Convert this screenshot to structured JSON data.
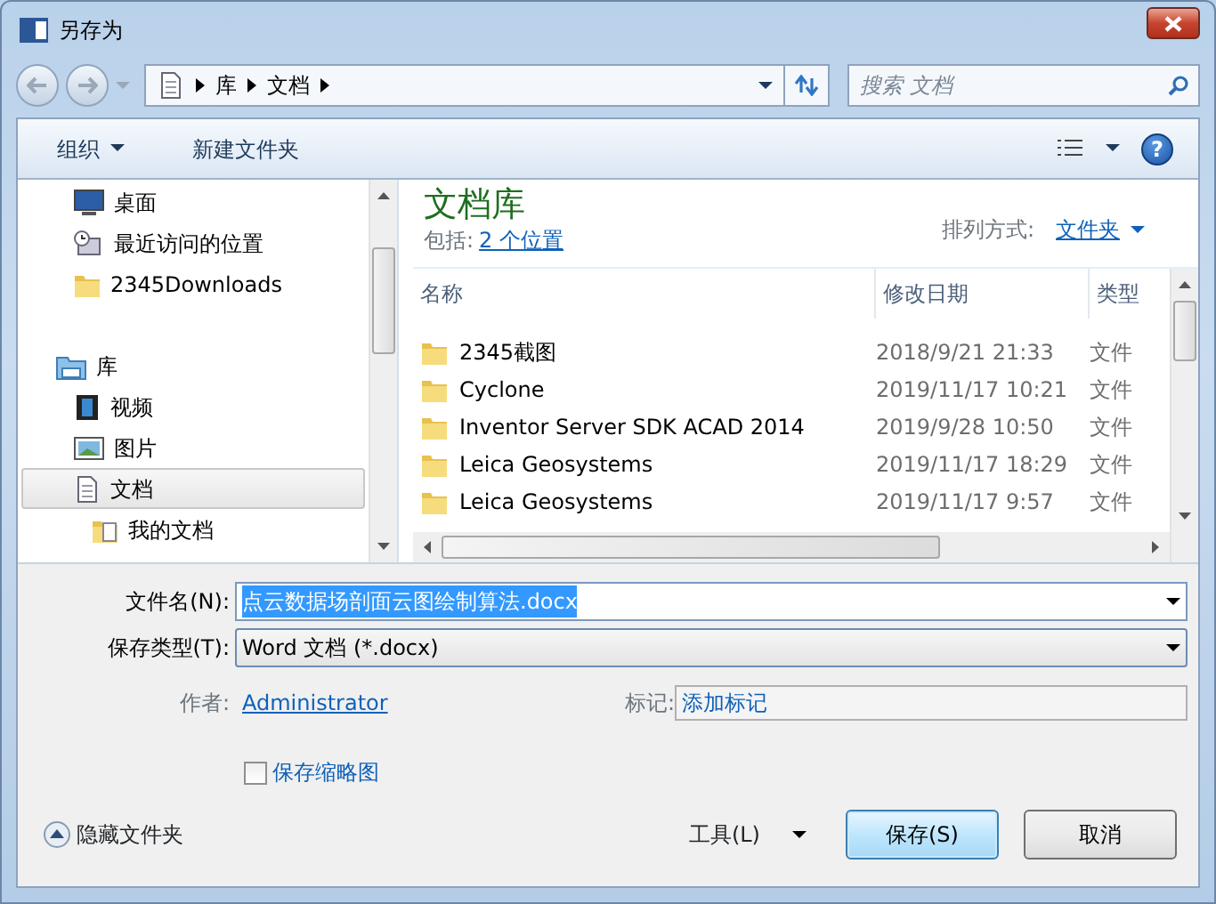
{
  "window": {
    "title": "另存为"
  },
  "address": {
    "path": [
      "库",
      "文档"
    ]
  },
  "search": {
    "placeholder": "搜索 文档"
  },
  "toolbar": {
    "organize": "组织",
    "new_folder": "新建文件夹",
    "help": "?"
  },
  "sidebar": {
    "items": [
      {
        "label": "桌面",
        "kind": "desktop",
        "selected": false
      },
      {
        "label": "最近访问的位置",
        "kind": "recent",
        "selected": false
      },
      {
        "label": "2345Downloads",
        "kind": "folder",
        "selected": false
      },
      {
        "label": "库",
        "kind": "library",
        "selected": false,
        "children": [
          {
            "label": "视频",
            "kind": "video",
            "selected": false
          },
          {
            "label": "图片",
            "kind": "picture",
            "selected": false
          },
          {
            "label": "文档",
            "kind": "document",
            "selected": true,
            "children": [
              {
                "label": "我的文档",
                "kind": "docfolder",
                "selected": false
              }
            ]
          }
        ]
      }
    ]
  },
  "content": {
    "title": "文档库",
    "includes_label": "包括:",
    "includes_link": "2 个位置",
    "arrange_label": "排列方式:",
    "arrange_value": "文件夹"
  },
  "table": {
    "columns": [
      "名称",
      "修改日期",
      "类型"
    ],
    "rows": [
      {
        "name": "2345截图",
        "date": "2018/9/21 21:33",
        "type": "文件"
      },
      {
        "name": "Cyclone",
        "date": "2019/11/17 10:21",
        "type": "文件"
      },
      {
        "name": "Inventor Server SDK ACAD 2014",
        "date": "2019/9/28 10:50",
        "type": "文件"
      },
      {
        "name": "Leica Geosystems",
        "date": "2019/11/17 18:29",
        "type": "文件"
      },
      {
        "name": "Leica Geosystems",
        "date": "2019/11/17 9:57",
        "type": "文件"
      }
    ]
  },
  "form": {
    "file_name": {
      "label": "文件名(N):",
      "value": "点云数据场剖面云图绘制算法.docx",
      "text_selected": true
    },
    "save_type": {
      "label": "保存类型(T):",
      "value": "Word 文档 (*.docx)"
    },
    "author": {
      "label": "作者:",
      "value": "Administrator"
    },
    "tags": {
      "label": "标记:",
      "placeholder": "添加标记"
    },
    "thumbnail": {
      "label": "保存缩略图",
      "checked": false
    }
  },
  "footer": {
    "hide_folders": "隐藏文件夹",
    "tools": "工具(L)",
    "buttons": [
      {
        "label": "保存(S)",
        "default": true
      },
      {
        "label": "取消",
        "default": false
      }
    ]
  }
}
